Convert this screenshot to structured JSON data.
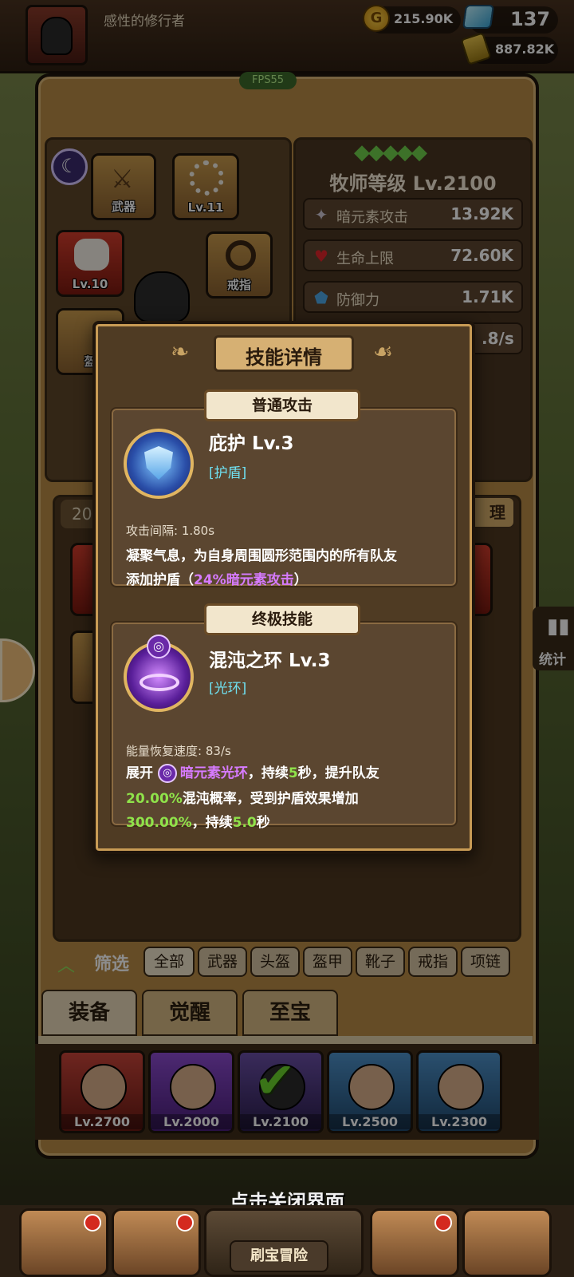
{
  "top": {
    "player_name": "感性的修行者",
    "gold": "215.90K",
    "gems": "137",
    "ore": "887.82K",
    "fps": "FPS55"
  },
  "equipment": {
    "slots": {
      "weapon": "武器",
      "accessory_level": "Lv.11",
      "helmet_level": "Lv.10",
      "ring": "戒指",
      "armor": "盔"
    }
  },
  "stats": {
    "level_title": "牧师等级 Lv.2100",
    "rows": [
      {
        "label": "暗元素攻击",
        "value": "13.92K"
      },
      {
        "label": "生命上限",
        "value": "72.60K"
      },
      {
        "label": "防御力",
        "value": "1.71K"
      }
    ],
    "partial_value": ".8/s"
  },
  "inventory": {
    "count_partial": "20",
    "button_partial": "理",
    "side_label": "统计"
  },
  "filter": {
    "label": "筛选",
    "buttons": [
      "全部",
      "武器",
      "头盔",
      "盔甲",
      "靴子",
      "戒指",
      "项链"
    ]
  },
  "tabs": [
    "装备",
    "觉醒",
    "至宝"
  ],
  "heroes": [
    {
      "level": "Lv.2700",
      "style": "red"
    },
    {
      "level": "Lv.2000",
      "style": "purple"
    },
    {
      "level": "Lv.2100",
      "style": "dark",
      "selected": true
    },
    {
      "level": "Lv.2500",
      "style": "blue"
    },
    {
      "level": "Lv.2300",
      "style": "blue"
    }
  ],
  "dialog": {
    "title": "技能详情",
    "normal": {
      "section": "普通攻击",
      "name": "庇护 Lv.3",
      "tag": "[护盾]",
      "meta": "攻击间隔: 1.80s",
      "desc_line1": "凝聚气息，为自身周围圆形范围内的所有队友",
      "desc_line2_pre": "添加护盾（",
      "desc_line2_hl": "24%暗元素攻击",
      "desc_line2_post": "）"
    },
    "ultimate": {
      "section": "终极技能",
      "name": "混沌之环 Lv.3",
      "tag": "[光环]",
      "meta": "能量恢复速度: 83/s",
      "d1_a": "展开 ",
      "d1_b": "暗元素光环",
      "d1_c": "，持续",
      "d1_d": "5",
      "d1_e": "秒，提升队友",
      "d2_a": "20.00%",
      "d2_b": "混沌概率，受到护盾效果增加",
      "d3_a": "300.00%",
      "d3_b": "，持续",
      "d3_c": "5.0",
      "d3_d": "秒"
    }
  },
  "bottom": {
    "close_hint": "点击关闭界面",
    "center_button": "刷宝冒险"
  }
}
